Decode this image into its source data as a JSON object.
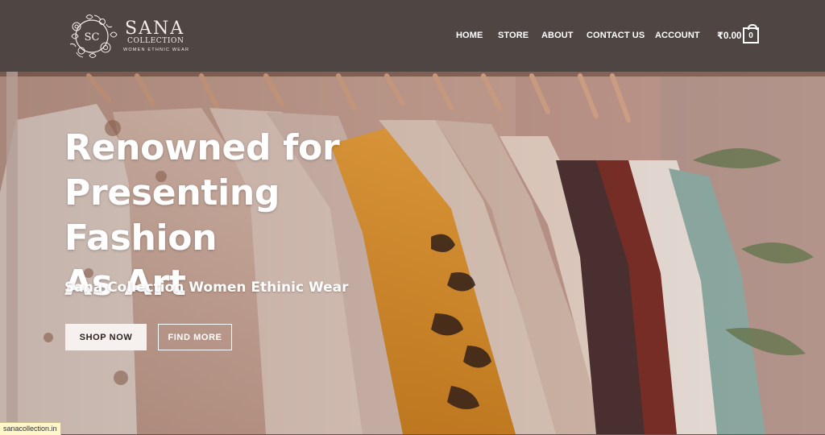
{
  "brand": {
    "name": "SANA",
    "collection": "COLLECTION",
    "tagline": "WOMEN ETHNIC WEAR",
    "monogram": "SC"
  },
  "nav": {
    "items": [
      {
        "label": "HOME"
      },
      {
        "label": "STORE"
      },
      {
        "label": "ABOUT"
      },
      {
        "label": "CONTACT US"
      },
      {
        "label": "ACCOUNT"
      }
    ]
  },
  "cart": {
    "total": "₹0.00",
    "count": "0"
  },
  "hero": {
    "title_line1": "Renowned for",
    "title_line2": "Presenting Fashion",
    "title_line3": "As Art",
    "subtitle": "Sana Collection Women Ethinic Wear",
    "primary_button": "SHOP NOW",
    "secondary_button": "FIND MORE"
  },
  "status_bar": {
    "url": "sanacollection.in"
  },
  "colors": {
    "header_bg": "#4f4542",
    "button_bg": "#f6f1ef",
    "text_white": "#ffffff"
  }
}
